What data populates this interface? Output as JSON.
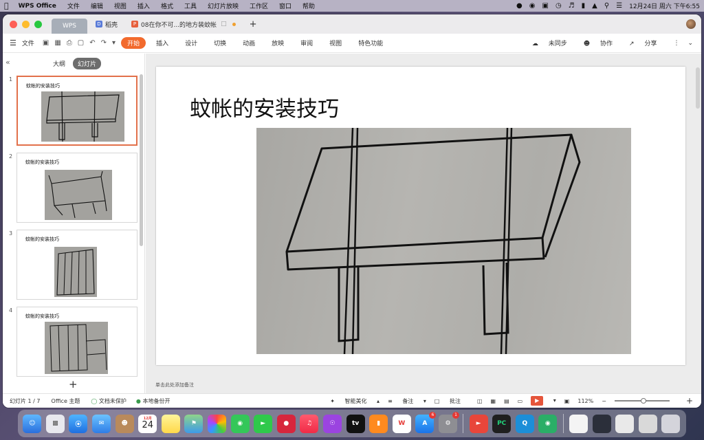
{
  "menubar": {
    "app_name": "WPS Office",
    "items": [
      "文件",
      "编辑",
      "视图",
      "插入",
      "格式",
      "工具",
      "幻灯片放映",
      "工作区",
      "窗口",
      "帮助"
    ],
    "clock": "12月24日 周六 下午6:55"
  },
  "tabs": [
    {
      "label": "WPS"
    },
    {
      "label": "稻壳",
      "icon": "docer-icon"
    },
    {
      "label": "08在你不可...的地方装蚊帐",
      "icon": "ppt-icon"
    }
  ],
  "toolbar": {
    "file_label": "文件",
    "ribbon_tabs": [
      "开始",
      "插入",
      "设计",
      "切换",
      "动画",
      "放映",
      "审阅",
      "视图",
      "特色功能"
    ],
    "active_tab": "开始",
    "sync_label": "未同步",
    "collab_label": "协作",
    "share_label": "分享"
  },
  "left_pane": {
    "tabs": [
      "大纲",
      "幻灯片"
    ],
    "active_tab": "幻灯片",
    "slides": [
      {
        "num": "1",
        "title": "蚊帐的安装技巧"
      },
      {
        "num": "2",
        "title": "蚊帐的安装技巧"
      },
      {
        "num": "3",
        "title": "蚊帐的安装技巧"
      },
      {
        "num": "4",
        "title": "蚊帐的安装技巧"
      }
    ],
    "add_label": "+"
  },
  "slide": {
    "title": "蚊帐的安装技巧",
    "photo": "hand-drawn-bed-frame-sketch"
  },
  "notes_placeholder": "单击此处添加备注",
  "statusbar": {
    "slide_counter": "幻灯片 1 / 7",
    "theme": "Office 主题",
    "doc_protect": "文档未保护",
    "backup": "本地备份开",
    "beautify": "智能美化",
    "notes": "备注",
    "comments": "批注",
    "zoom": "112%"
  },
  "dock": {
    "calendar_month": "12月",
    "calendar_day": "24",
    "appstore_badge": "6",
    "settings_badge": "1"
  },
  "colors": {
    "accent": "#f26a2d",
    "selection": "#e2704a",
    "play": "#e5553b"
  }
}
